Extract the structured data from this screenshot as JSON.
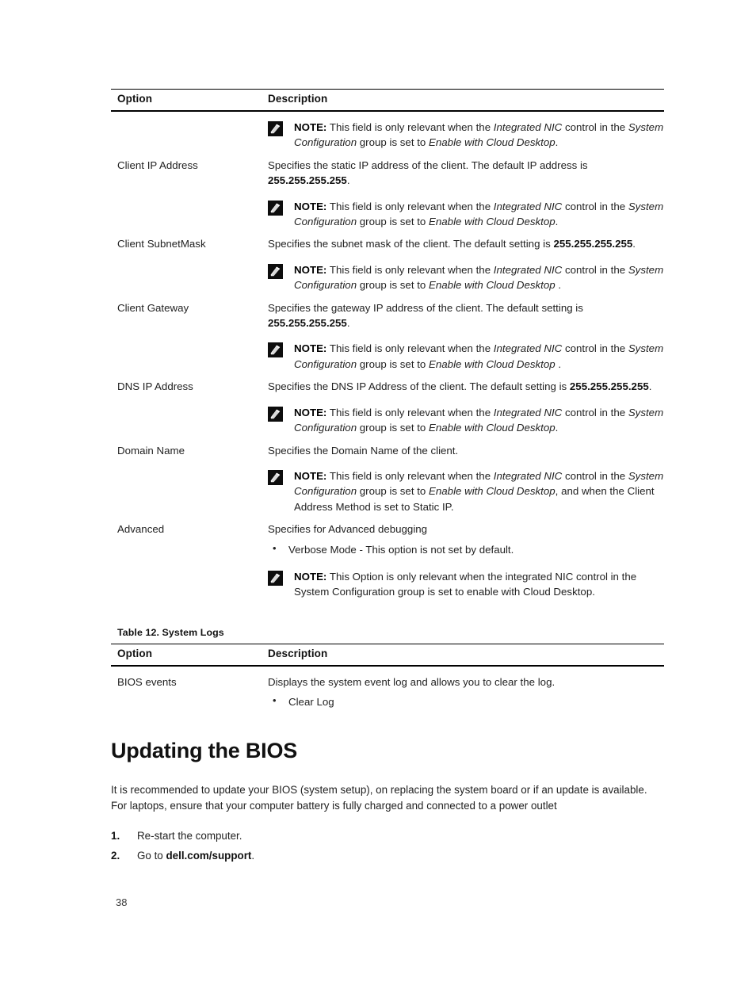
{
  "page": {
    "number": "38"
  },
  "table_options": {
    "headers": {
      "option": "Option",
      "description": "Description"
    },
    "rows": [
      {
        "option": "",
        "note_before": {
          "label": "NOTE:",
          "segments": [
            {
              "t": "This field is only relevant when the ",
              "style": "normal"
            },
            {
              "t": "Integrated NIC",
              "style": "italic"
            },
            {
              "t": " control in the ",
              "style": "normal"
            },
            {
              "t": "System Configuration",
              "style": "italic"
            },
            {
              "t": " group is set to ",
              "style": "normal"
            },
            {
              "t": "Enable with Cloud Desktop",
              "style": "italic"
            },
            {
              "t": ".",
              "style": "normal"
            }
          ],
          "plain": "NOTE: This field is only relevant when the Integrated NIC control in the System Configuration group is set to Enable with Cloud Desktop."
        }
      },
      {
        "option": "Client IP Address",
        "desc_lead": "Specifies the static IP address of the client. The default IP address is ",
        "desc_bold": "255.255.255.255",
        "desc_tail": "."
      },
      {
        "option": "Client SubnetMask",
        "desc_lead": "Specifies the subnet mask of the client. The default setting is ",
        "desc_bold": "255.255.255.255",
        "desc_tail": "."
      },
      {
        "option": "Client Gateway",
        "desc_lead": "Specifies the gateway IP address of the client. The default setting is ",
        "desc_bold": "255.255.255.255",
        "desc_tail": "."
      },
      {
        "option": "DNS IP Address",
        "desc_lead": "Specifies the DNS IP Address of the client. The default setting is ",
        "desc_bold": "255.255.255.255",
        "desc_tail": "."
      },
      {
        "option": "Domain Name",
        "desc_lead": "Specifies the Domain Name of the client.",
        "desc_bold": "",
        "desc_tail": ""
      },
      {
        "option": "Advanced",
        "desc_lead": "Specifies for Advanced debugging",
        "desc_bold": "",
        "desc_tail": "",
        "bullets": [
          "Verbose Mode - This option is not set by default."
        ]
      }
    ],
    "notes": {
      "label": "NOTE:",
      "n1_a": "This field is only relevant when the ",
      "n1_b": "Integrated NIC",
      "n1_c": " control in the ",
      "n1_d": "System Configuration",
      "n1_e": " group is set to ",
      "n1_f": "Enable with Cloud Desktop",
      "n1_g": ".",
      "n2_g": " .",
      "n3_g": ",",
      "n3_extra": " and when the Client Address Method is set to Static IP.",
      "n4_full_a": "This Option is only relevant when the integrated NIC control in the System Configuration group is set to enable with Cloud Desktop."
    }
  },
  "table_system_logs": {
    "caption": "Table 12. System Logs",
    "headers": {
      "option": "Option",
      "description": "Description"
    },
    "rows": [
      {
        "option": "BIOS events",
        "description": "Displays the system event log and allows you to clear the log.",
        "bullets": [
          "Clear Log"
        ]
      }
    ]
  },
  "section": {
    "heading": "Updating the BIOS",
    "paragraph": "It is recommended to update your BIOS (system setup), on replacing the system board or if an update is available. For laptops, ensure that your computer battery is fully charged and connected to a power outlet",
    "steps": [
      {
        "text_lead": "Re-start the computer.",
        "bold": "",
        "tail": ""
      },
      {
        "text_lead": "Go to ",
        "bold": "dell.com/support",
        "tail": "."
      }
    ]
  },
  "colors": {
    "text": "#222222",
    "heading": "#111111",
    "rule": "#000000",
    "icon_bg": "#0d0d0d"
  }
}
